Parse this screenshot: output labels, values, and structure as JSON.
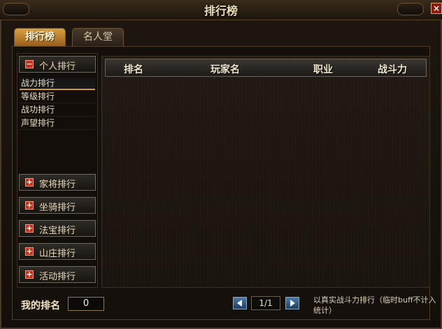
{
  "window": {
    "title": "排行榜",
    "close_label": "×"
  },
  "tabs": [
    {
      "label": "排行榜",
      "active": true
    },
    {
      "label": "名人堂",
      "active": false
    }
  ],
  "sidebar": {
    "expanded_category": {
      "label": "个人排行",
      "icon": "minus-icon"
    },
    "sub_items": [
      {
        "label": "战力排行",
        "selected": true
      },
      {
        "label": "等级排行",
        "selected": false
      },
      {
        "label": "战功排行",
        "selected": false
      },
      {
        "label": "声望排行",
        "selected": false
      }
    ],
    "collapsed_categories": [
      {
        "label": "家将排行",
        "icon": "plus-icon"
      },
      {
        "label": "坐骑排行",
        "icon": "plus-icon"
      },
      {
        "label": "法宝排行",
        "icon": "plus-icon"
      },
      {
        "label": "山庄排行",
        "icon": "plus-icon"
      },
      {
        "label": "活动排行",
        "icon": "plus-icon"
      }
    ]
  },
  "table": {
    "columns": [
      "排名",
      "玩家名",
      "职业",
      "战斗力"
    ],
    "rows": []
  },
  "footer": {
    "my_rank_label": "我的排名",
    "my_rank_value": "0",
    "page_indicator": "1/1",
    "note": "以真实战斗力排行（临时buff不计入统计）"
  },
  "colors": {
    "accent": "#d49a3a",
    "active_tab": "#c38a36",
    "close_button": "#8a1a10",
    "pager_button": "#3a6a98"
  }
}
